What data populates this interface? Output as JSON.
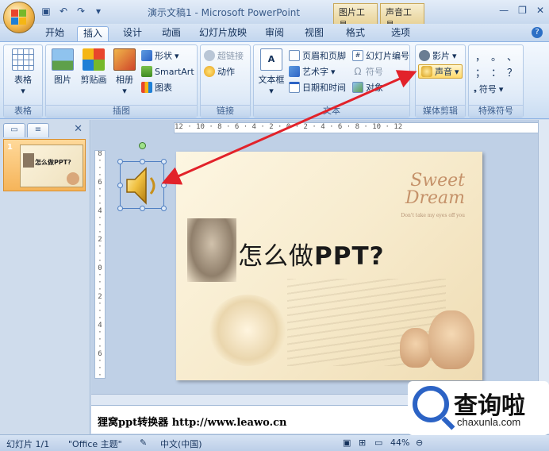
{
  "window": {
    "title": "演示文稿1 - Microsoft PowerPoint",
    "contextual_tabs": [
      "图片工具",
      "声音工具"
    ]
  },
  "tabs": [
    "开始",
    "插入",
    "设计",
    "动画",
    "幻灯片放映",
    "审阅",
    "视图",
    "格式",
    "选项"
  ],
  "active_tab": "插入",
  "ribbon": {
    "table_group": {
      "button": "表格",
      "label": "表格"
    },
    "illustrations_group": {
      "picture": "图片",
      "clipart": "剪贴画",
      "album": "相册",
      "shapes": "形状",
      "smartart": "SmartArt",
      "chart": "图表",
      "label": "插图"
    },
    "links_group": {
      "hyperlink": "超链接",
      "action": "动作",
      "label": "链接"
    },
    "text_group": {
      "textbox": "文本框",
      "header_footer": "页眉和页脚",
      "wordart": "艺术字",
      "datetime": "日期和时间",
      "slide_number": "幻灯片编号",
      "symbol": "符号",
      "object": "对象",
      "label": "文本"
    },
    "media_group": {
      "movie": "影片",
      "sound": "声音",
      "label": "媒体剪辑"
    },
    "special_symbols_group": {
      "symbol": "符号",
      "label": "特殊符号",
      "chars": [
        "，",
        "。",
        "、",
        "；",
        "：",
        "？"
      ]
    }
  },
  "left_panel": {
    "slide_number": "1",
    "thumb_title": "怎么做PPT?"
  },
  "rulers": {
    "h": "12 · 10 · 8 · 6 · 4 · 2 · 0 · 2 · 4 · 6 · 8 · 10 · 12",
    "v": [
      "8",
      "6",
      "4",
      "2",
      "0",
      "2",
      "4",
      "6",
      "8"
    ]
  },
  "slide": {
    "title_cn": "怎么做",
    "title_en": "PPT?",
    "sweet": "Sweet",
    "dream": "Dream",
    "tagline": "Don't take my eyes off you"
  },
  "notes": {
    "text": "狸窝ppt转换器   http://www.leawo.cn"
  },
  "status": {
    "slide": "幻灯片 1/1",
    "theme": "\"Office 主题\"",
    "language": "中文(中国)",
    "zoom": "44%"
  },
  "watermark": {
    "cn": "查询啦",
    "url": "chaxunla.com"
  },
  "colors": {
    "accent": "#2c63c5",
    "arrow": "#e2222a",
    "ribbon": "#dbe8f7"
  }
}
